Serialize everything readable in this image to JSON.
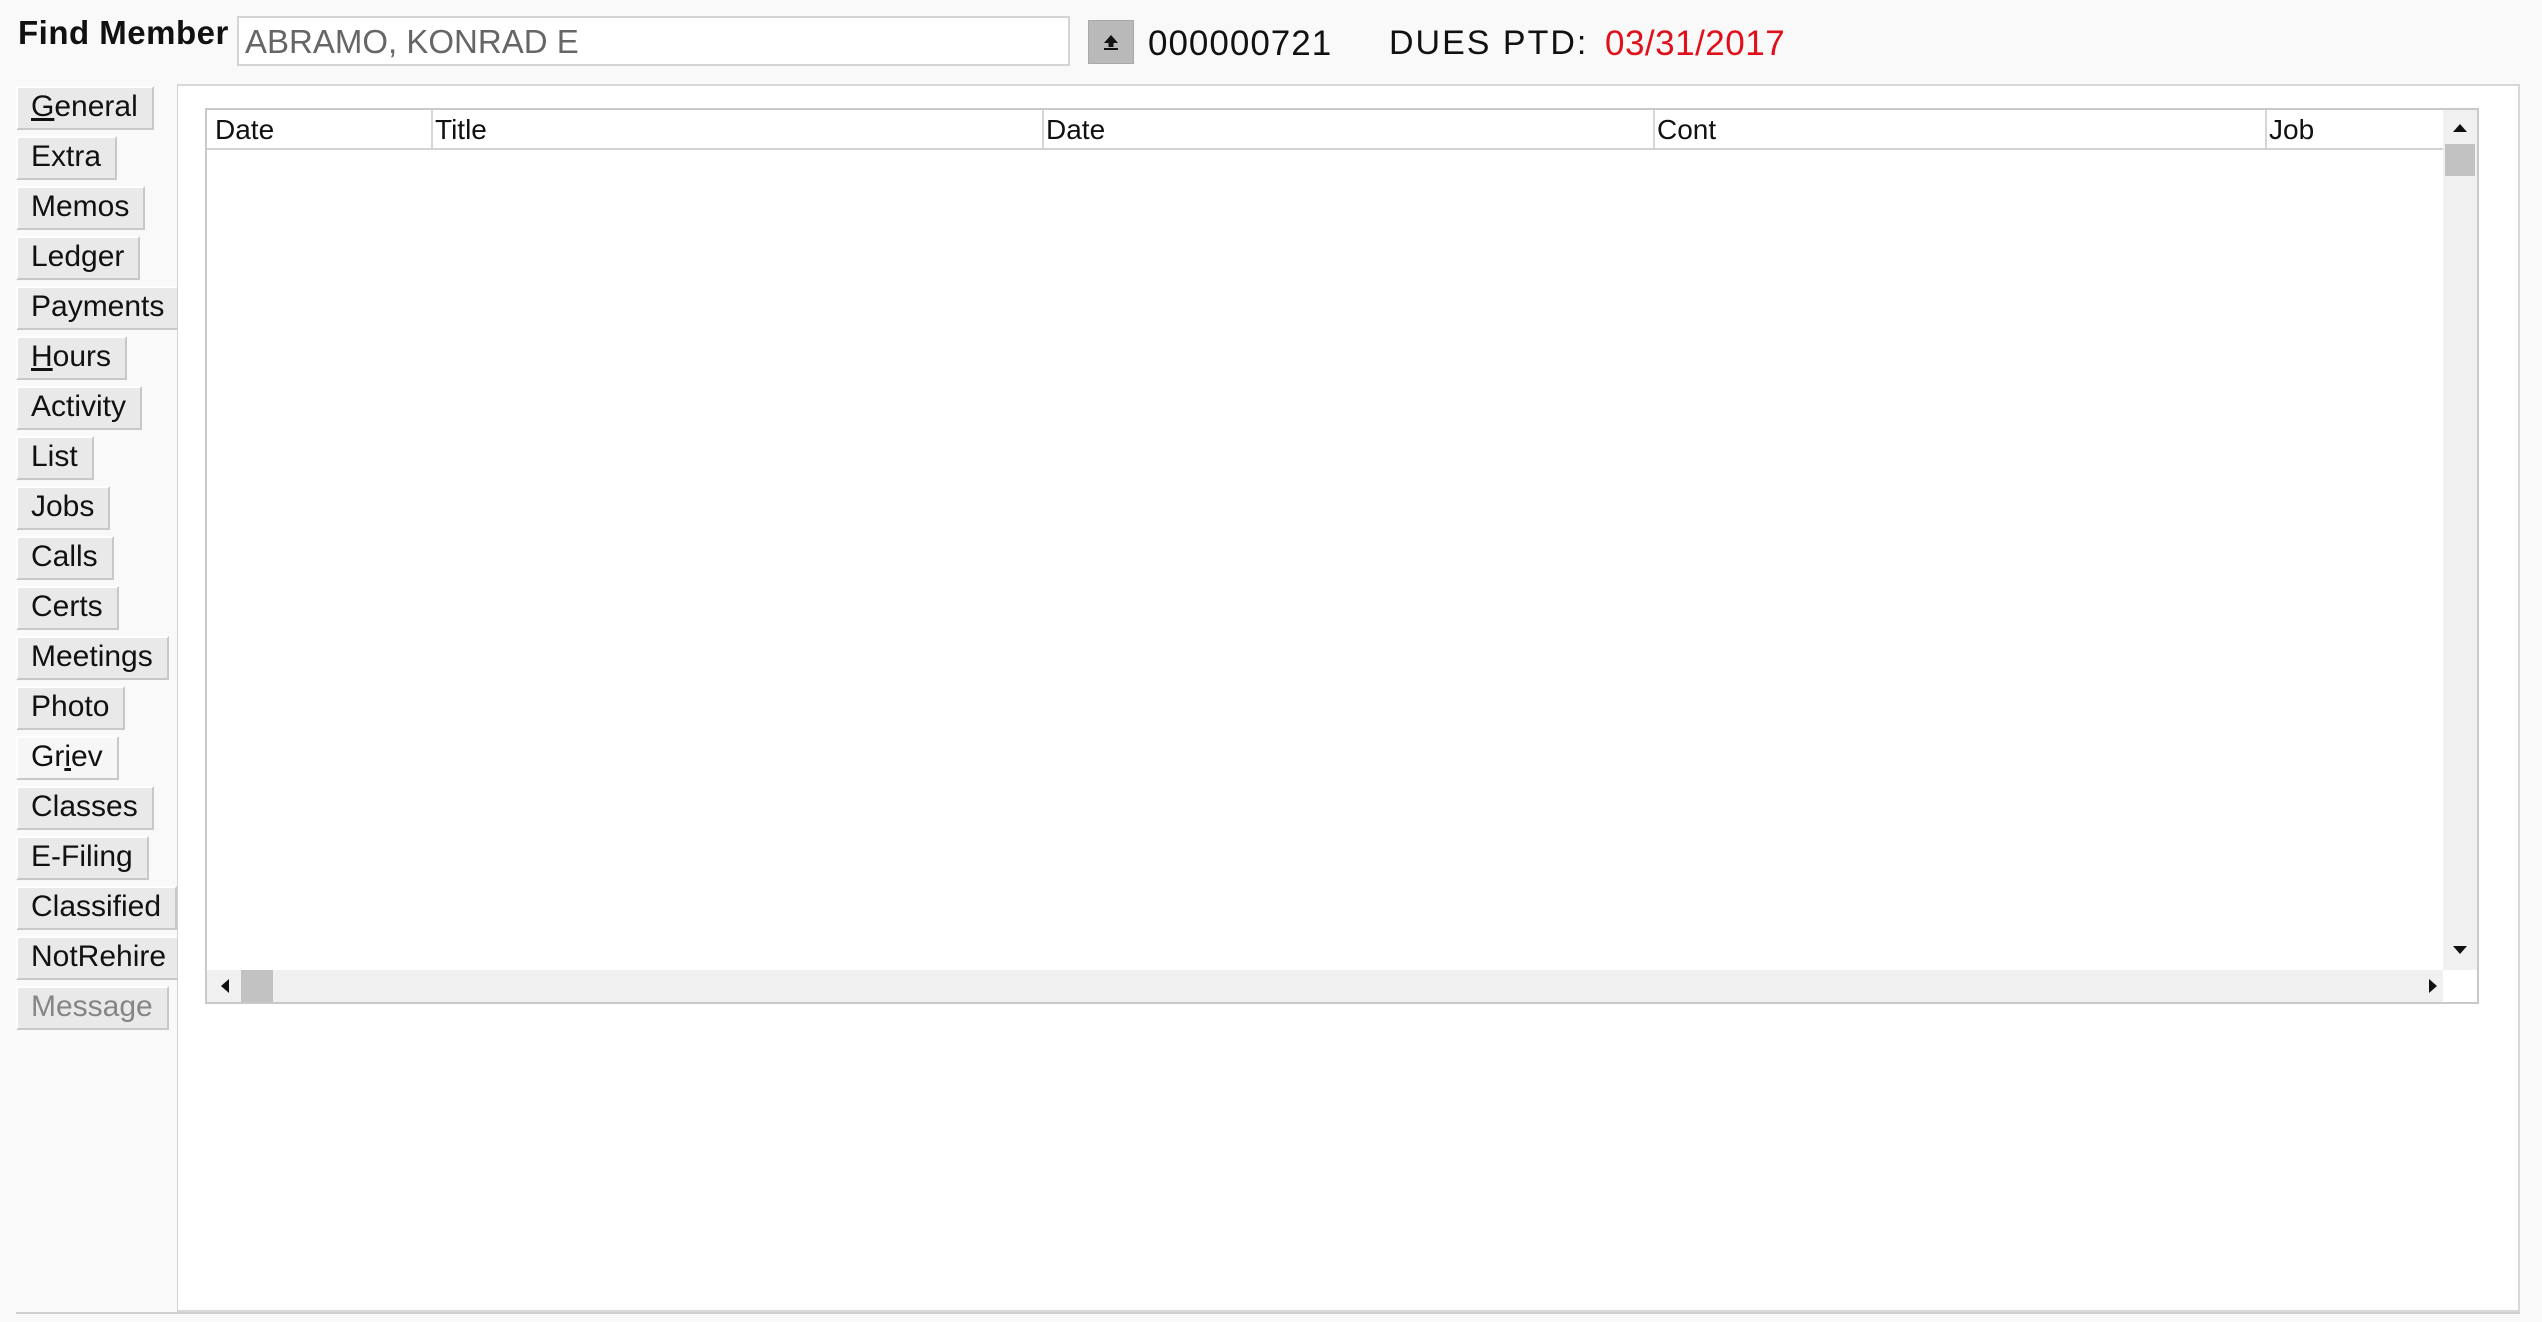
{
  "header": {
    "find_label": "Find Member",
    "member_name": "ABRAMO, KONRAD E",
    "member_number": "000000721",
    "dues_label": "DUES PTD:",
    "dues_date": "03/31/2017",
    "lookup_icon": "upload-arrow-icon"
  },
  "tabs": [
    {
      "label": "General",
      "mnemonic_index": 0,
      "state": "normal"
    },
    {
      "label": "Extra",
      "state": "normal"
    },
    {
      "label": "Memos",
      "state": "normal"
    },
    {
      "label": "Ledger",
      "state": "normal"
    },
    {
      "label": "Payments",
      "state": "normal"
    },
    {
      "label": "Hours",
      "mnemonic_index": 0,
      "state": "normal"
    },
    {
      "label": "Activity",
      "state": "normal"
    },
    {
      "label": "List",
      "state": "normal"
    },
    {
      "label": "Jobs",
      "state": "normal"
    },
    {
      "label": "Calls",
      "state": "normal"
    },
    {
      "label": "Certs",
      "state": "normal"
    },
    {
      "label": "Meetings",
      "state": "normal"
    },
    {
      "label": "Photo",
      "state": "normal"
    },
    {
      "label": "Griev",
      "mnemonic_index": 2,
      "state": "active"
    },
    {
      "label": "Classes",
      "state": "normal"
    },
    {
      "label": "E-Filing",
      "state": "normal"
    },
    {
      "label": "Classified",
      "state": "normal"
    },
    {
      "label": "NotRehire",
      "state": "normal"
    },
    {
      "label": "Message",
      "state": "disabled"
    }
  ],
  "grid": {
    "columns": [
      "Date",
      "Title",
      "Date",
      "Cont",
      "Job"
    ],
    "rows": []
  },
  "colors": {
    "dues_date": "#e0101a",
    "background": "#f9f9f9",
    "panel": "#ffffff"
  }
}
